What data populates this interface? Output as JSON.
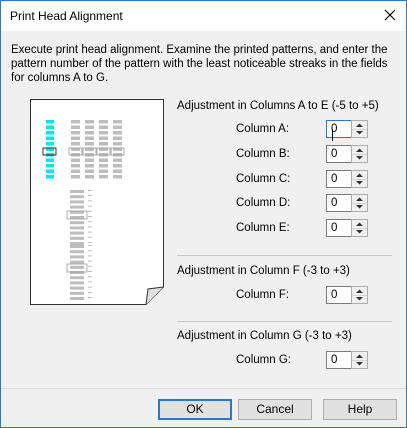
{
  "window": {
    "title": "Print Head Alignment"
  },
  "instructions": "Execute print head alignment. Examine the printed patterns, and enter the pattern number of the pattern with the least noticeable streaks in the fields for columns A to G.",
  "groups": [
    {
      "label": "Adjustment in Columns A to E (-5 to +5)",
      "rows": [
        {
          "label": "Column A:",
          "value": "0"
        },
        {
          "label": "Column B:",
          "value": "0"
        },
        {
          "label": "Column C:",
          "value": "0"
        },
        {
          "label": "Column D:",
          "value": "0"
        },
        {
          "label": "Column E:",
          "value": "0"
        }
      ]
    },
    {
      "label": "Adjustment in Column F (-3 to +3)",
      "rows": [
        {
          "label": "Column F:",
          "value": "0"
        }
      ]
    },
    {
      "label": "Adjustment in Column G (-3 to +3)",
      "rows": [
        {
          "label": "Column G:",
          "value": "0"
        }
      ]
    }
  ],
  "buttons": {
    "ok": "OK",
    "cancel": "Cancel",
    "help": "Help"
  },
  "colors": {
    "accent": "#2b78c9",
    "highlight": "#00e5ee"
  }
}
